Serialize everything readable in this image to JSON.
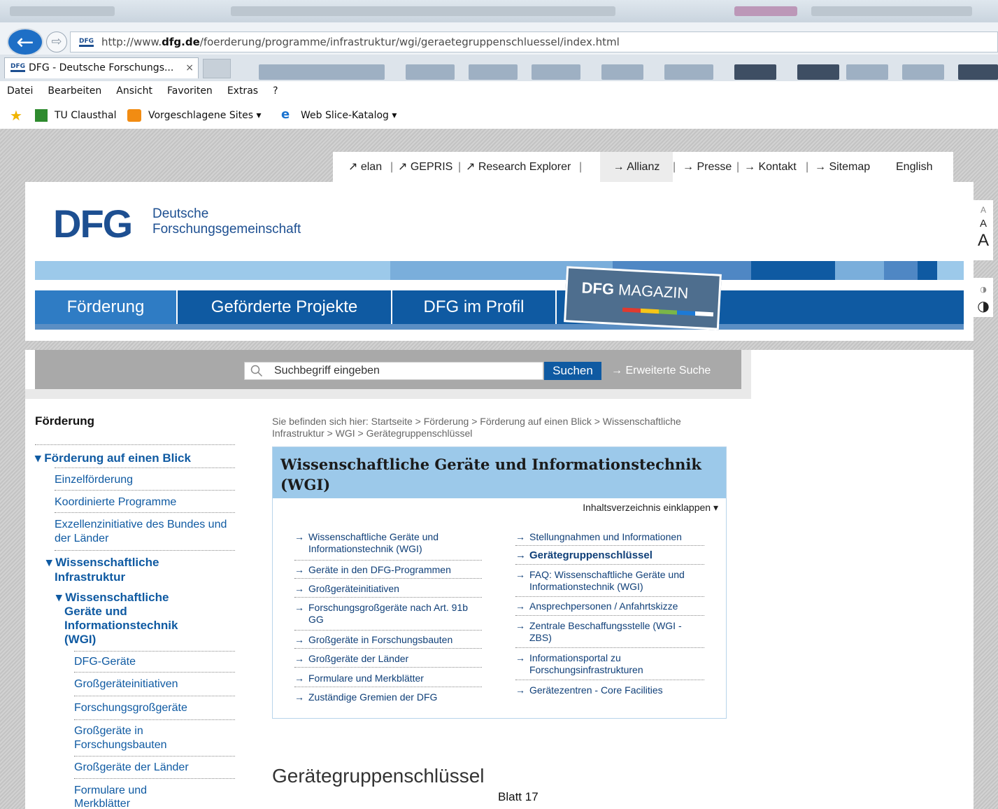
{
  "browser": {
    "url_prefix": "http://www.",
    "url_domain": "dfg.de",
    "url_path": "/foerderung/programme/infrastruktur/wgi/geraetegruppenschluessel/index.html",
    "favicon_text": "DFG",
    "tab_title": "DFG - Deutsche Forschungs...",
    "tab_close": "×",
    "back_glyph": "←",
    "forward_glyph": "⇨",
    "menu": [
      "Datei",
      "Bearbeiten",
      "Ansicht",
      "Favoriten",
      "Extras",
      "?"
    ],
    "favorites": {
      "tu": "TU Clausthal",
      "suggested": "Vorgeschlagene Sites ▾",
      "webslice": "Web Slice-Katalog ▾",
      "ie_glyph": "e"
    }
  },
  "service_nav": {
    "elan": "↗ elan",
    "gepris": "↗ GEPRIS",
    "research": "↗ Research Explorer",
    "allianz": "→ Allianz",
    "presse": "→ Presse",
    "kontakt": "→ Kontakt",
    "sitemap": "→ Sitemap",
    "english": "English",
    "sep": "|"
  },
  "logo": {
    "mark": "DFG",
    "line1": "Deutsche",
    "line2": "Forschungsgemeinschaft"
  },
  "main_nav": [
    "Förderung",
    "Geförderte Projekte",
    "DFG im Profil"
  ],
  "magazin": {
    "bold": "DFG",
    "rest": " MAGAZIN"
  },
  "font_tool": [
    "A",
    "A",
    "A"
  ],
  "contrast_tool": [
    "◑",
    "◑"
  ],
  "search": {
    "placeholder": "Suchbegriff eingeben",
    "button": "Suchen",
    "advanced": "→ Erweiterte Suche",
    "icon": "magnifier-icon"
  },
  "left_nav": {
    "heading": "Förderung",
    "items": [
      "▾ Förderung auf einen Blick",
      "Einzelförderung",
      "Koordinierte Programme",
      "Exzellenzinitiative des Bundes und der Länder",
      "▾ Wissenschaftliche Infrastruktur",
      "▾ Wissenschaftliche Geräte und Informationstechnik (WGI)",
      "DFG-Geräte",
      "Großgeräteinitiativen",
      "Forschungsgroßgeräte",
      "Großgeräte in Forschungsbauten",
      "Großgeräte der Länder",
      "Formulare und Merkblätter"
    ]
  },
  "breadcrumb": "Sie befinden sich hier: Startseite > Förderung > Förderung auf einen Blick > Wissenschaftliche Infrastruktur > WGI > Gerätegruppenschlüssel",
  "toc": {
    "title": "Wissenschaftliche Geräte und Informationstechnik (WGI)",
    "fold": "Inhaltsverzeichnis einklappen ▾",
    "arrow": "→",
    "left": [
      "Wissenschaftliche Geräte und Informationstechnik (WGI)",
      "Geräte in den DFG-Programmen",
      "Großgeräteinitiativen",
      "Forschungsgroßgeräte nach Art. 91b GG",
      "Großgeräte in Forschungsbauten",
      "Großgeräte der Länder",
      "Formulare und Merkblätter",
      "Zuständige Gremien der DFG"
    ],
    "right": [
      "Stellungnahmen und Informationen",
      "Gerätegruppenschlüssel",
      "FAQ: Wissenschaftliche Geräte und Informationstechnik (WGI)",
      "Ansprechpersonen / Anfahrtskizze",
      "Zentrale Beschaffungsstelle (WGI - ZBS)",
      "Informationsportal zu Forschungsinfrastrukturen",
      "Gerätezentren - Core Facilities"
    ]
  },
  "page_title": "Gerätegruppenschlüssel",
  "footer_label": "Blatt 17"
}
